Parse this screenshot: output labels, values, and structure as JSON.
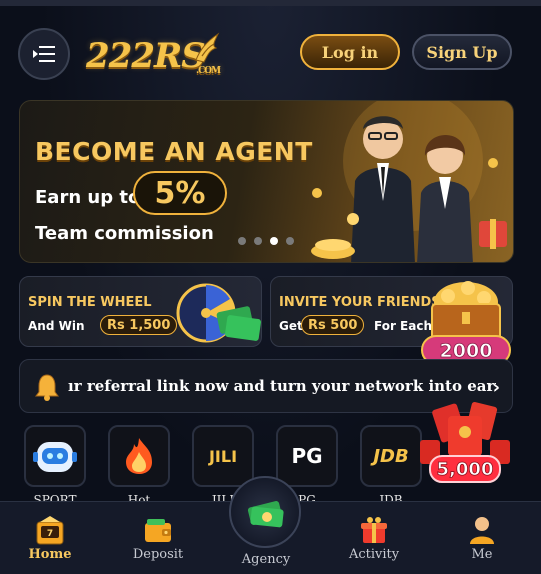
{
  "header": {
    "logo_text": "222RS",
    "logo_suffix": ".COM",
    "login_label": "Log in",
    "signup_label": "Sign Up"
  },
  "hero": {
    "title": "BECOME AN AGENT",
    "earn_text": "Earn up to",
    "percent": "5%",
    "team_text": "Team commission",
    "slides": 4,
    "active_slide": 3
  },
  "promos": [
    {
      "title": "SPIN THE WHEEL",
      "prefix": "And Win",
      "amount": "Rs 1,500",
      "suffix": ""
    },
    {
      "title": "INVITE YOUR FRIENDS",
      "prefix": "Get",
      "amount": "Rs 500",
      "suffix": "For Each",
      "badge": "2000"
    }
  ],
  "marquee": {
    "text": "ır referral link now and turn your network into earning"
  },
  "categories": [
    {
      "name": "robot",
      "caption": "SPORT"
    },
    {
      "name": "hot",
      "caption": "Hot"
    },
    {
      "name": "jili",
      "caption": "JILI"
    },
    {
      "name": "pg",
      "caption": "PG"
    },
    {
      "name": "jdb",
      "caption": "JDB"
    },
    {
      "name": "gift",
      "caption": "",
      "badge": "5,000"
    }
  ],
  "category_labels": {
    "jili": "JILI",
    "pg": "PG",
    "jdb": "JDB"
  },
  "nav": [
    {
      "label": "Home",
      "active": true
    },
    {
      "label": "Deposit",
      "active": false
    },
    {
      "label": "Agency",
      "active": false
    },
    {
      "label": "Activity",
      "active": false
    },
    {
      "label": "Me",
      "active": false
    }
  ],
  "colors": {
    "accent_gold": "#f7c860",
    "background": "#0b0f1a",
    "nav_bg": "#151a29"
  }
}
